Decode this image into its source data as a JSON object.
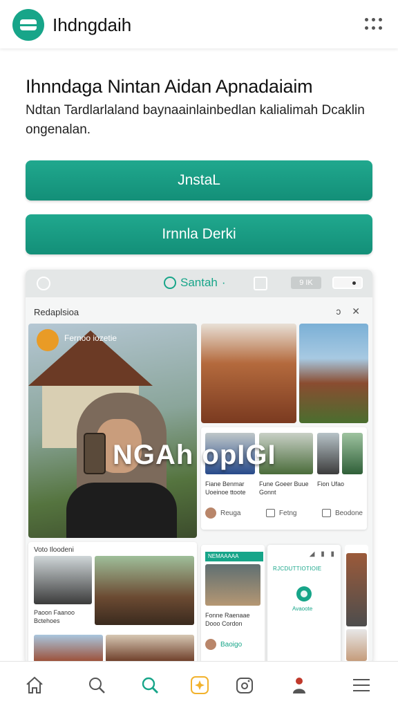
{
  "header": {
    "app_title": "Ihdngdaih",
    "logo_icon": "app-logo-icon",
    "menu_icon": "more-options-icon"
  },
  "hero": {
    "title": "Ihnndaga Nintan Aidan Apnadaiaim",
    "subtitle": "Ndtan Tardlarlaland baynaainlainbedlan kalialimah Dcaklin ongenalan."
  },
  "buttons": {
    "install": "JnstaL",
    "learn_more": "Irnnla Derki"
  },
  "preview": {
    "search_label": "Santah",
    "chip_label": "9 IK",
    "tab_label": "Redaplsioa",
    "close_icons": "ↄ ✕",
    "main_photo": {
      "badge_label": "Fernoo iozetie",
      "overlay_text": "NGAh opIGI"
    },
    "mid_card": {
      "captions": [
        "Fiane Benmar Uoeinoe ttoote",
        "Fune Goeer Buue Gonnt",
        "Fion Ufao"
      ],
      "actions": [
        "Reuga",
        "Fetng",
        "Beodone"
      ]
    },
    "left_card": {
      "label": "Voto Iloodeni",
      "caption": "Paoon Faanoo Bctehoes"
    },
    "news_card": {
      "tag": "NEMAAAAA",
      "caption": "Fonne Raenaae Dooo Cordon",
      "action": "Baoigo"
    },
    "dialog_card": {
      "icons": "◢ ▮ ▮",
      "title": "RJCDUTTIOTIOIE",
      "label": "Avaoote"
    }
  },
  "bottom_nav": {
    "items": [
      "home-icon",
      "search-icon",
      "discover-icon",
      "sparkle-icon",
      "camera-icon",
      "profile-icon",
      "menu-icon"
    ],
    "accent": "#17a589",
    "highlight": "#f2b22c"
  },
  "colors": {
    "primary": "#17a589",
    "text": "#111111",
    "background": "#ffffff"
  }
}
